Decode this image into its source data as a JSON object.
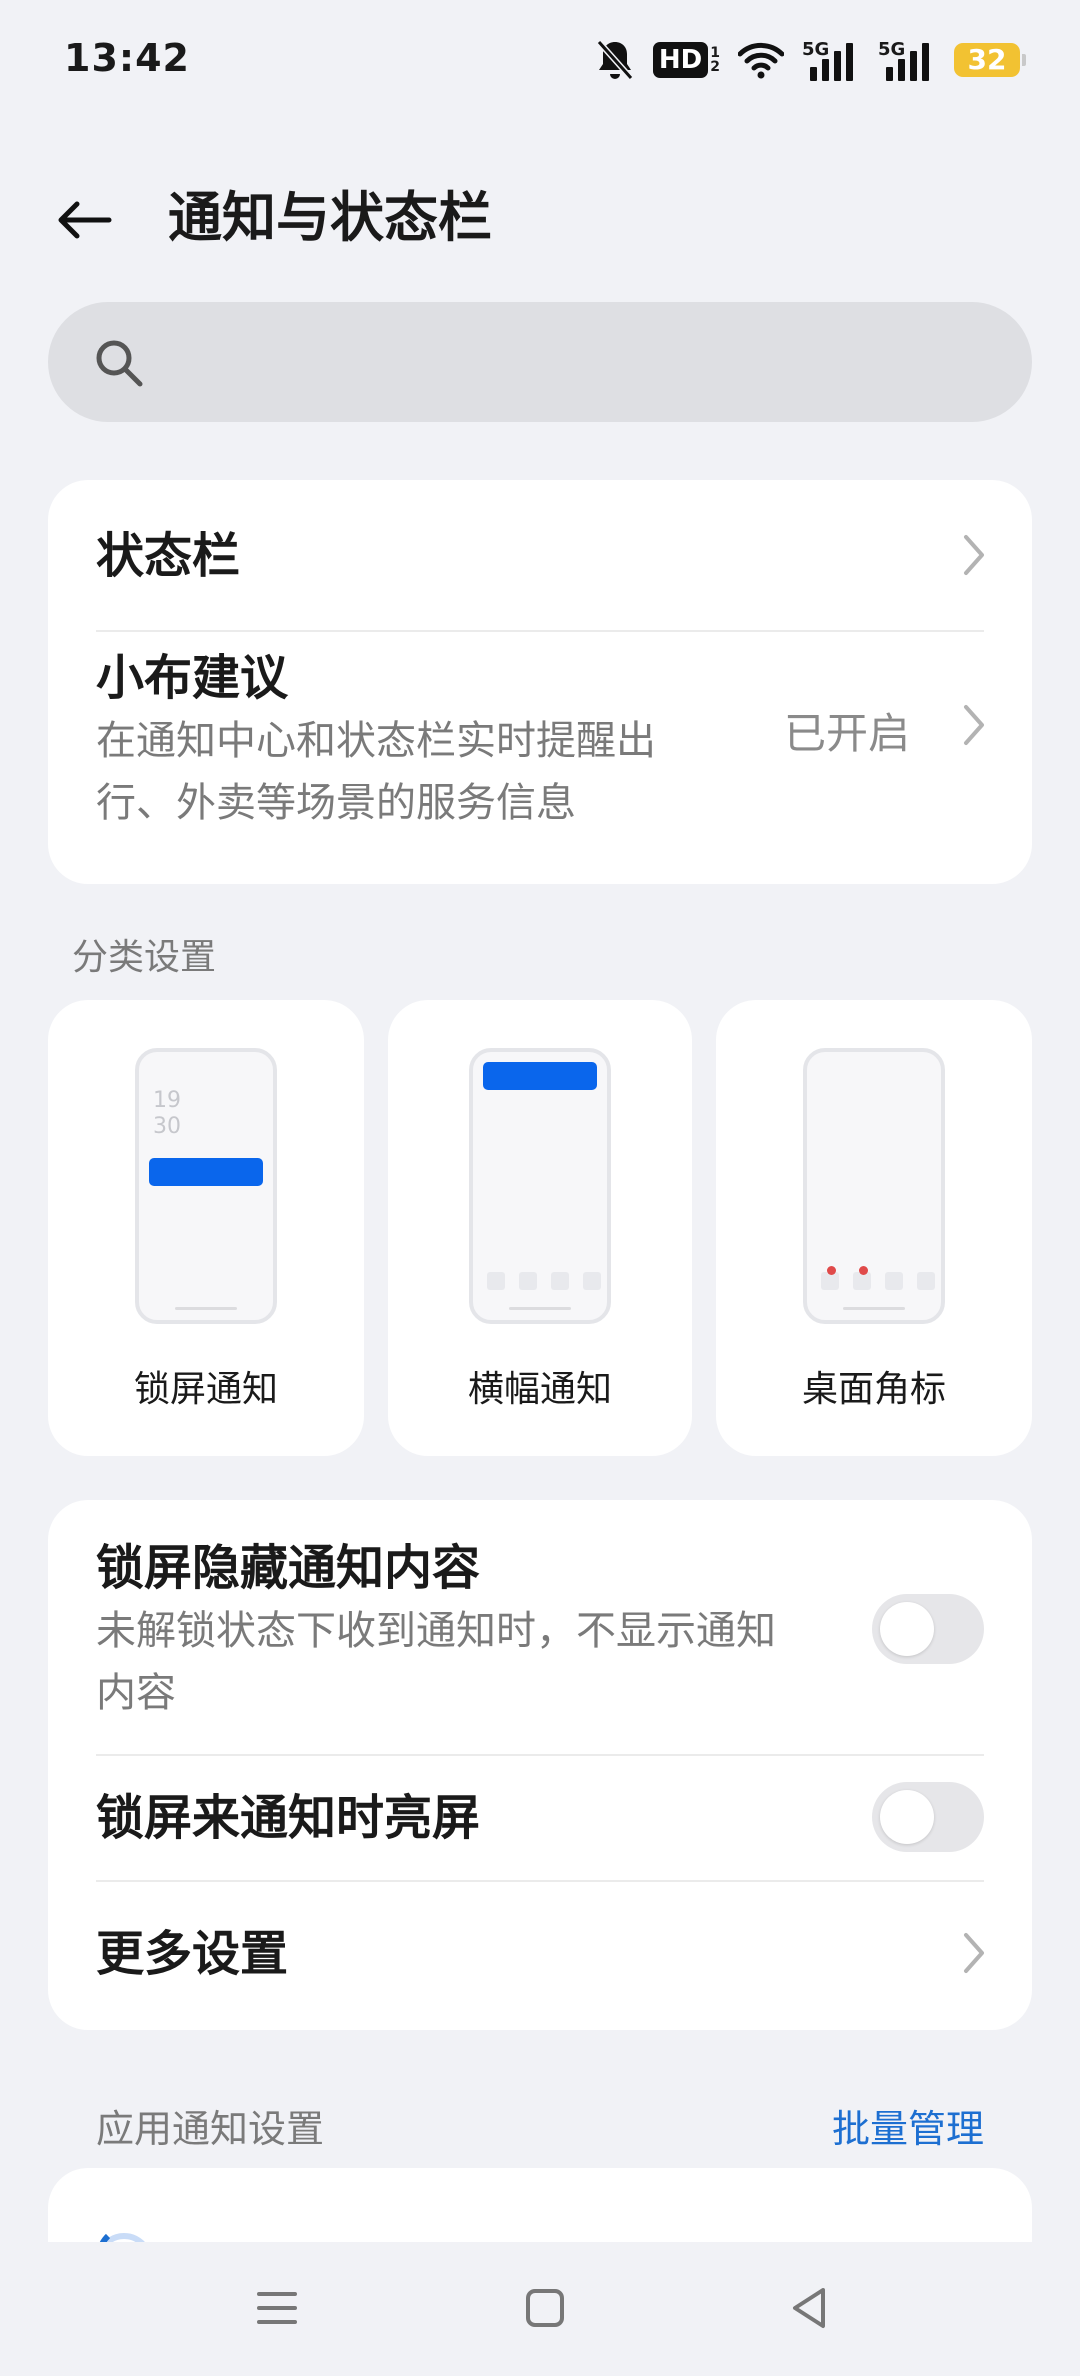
{
  "status_bar": {
    "time": "13:42",
    "hd_label": "HD",
    "hd_sub_top": "1",
    "hd_sub_bottom": "2",
    "sim1_label": "5G",
    "sim2_label": "5G",
    "battery_level": "32",
    "icons": [
      "bell-off-icon",
      "hd-voice-icon",
      "wifi-icon",
      "signal-5g-icon",
      "signal-5g-icon",
      "battery-icon"
    ]
  },
  "header": {
    "title": "通知与状态栏",
    "back_icon": "back-arrow-icon"
  },
  "search": {
    "placeholder": "",
    "icon": "search-icon"
  },
  "top_card": {
    "status_bar_item": {
      "label": "状态栏"
    },
    "xiaobu_item": {
      "label": "小布建议",
      "description_line1": "在通知中心和状态栏实时提醒出",
      "description_line2": "行、外卖等场景的服务信息",
      "value": "已开启"
    }
  },
  "category_section": {
    "label": "分类设置",
    "tiles": [
      {
        "label": "锁屏通知",
        "clock_hour": "19",
        "clock_min": "30"
      },
      {
        "label": "横幅通知"
      },
      {
        "label": "桌面角标"
      }
    ]
  },
  "lock_card": {
    "hide_content": {
      "label": "锁屏隐藏通知内容",
      "description_line1": "未解锁状态下收到通知时，不显示通知",
      "description_line2": "内容",
      "enabled": false
    },
    "wake_screen": {
      "label": "锁屏来通知时亮屏",
      "enabled": false
    },
    "more_settings": {
      "label": "更多设置"
    }
  },
  "app_section": {
    "label": "应用通知设置",
    "action": "批量管理"
  },
  "colors": {
    "background": "#f1f2f6",
    "card": "#ffffff",
    "accent_blue": "#0a66ec",
    "link_blue": "#1d6fd1",
    "battery": "#f2c232"
  }
}
